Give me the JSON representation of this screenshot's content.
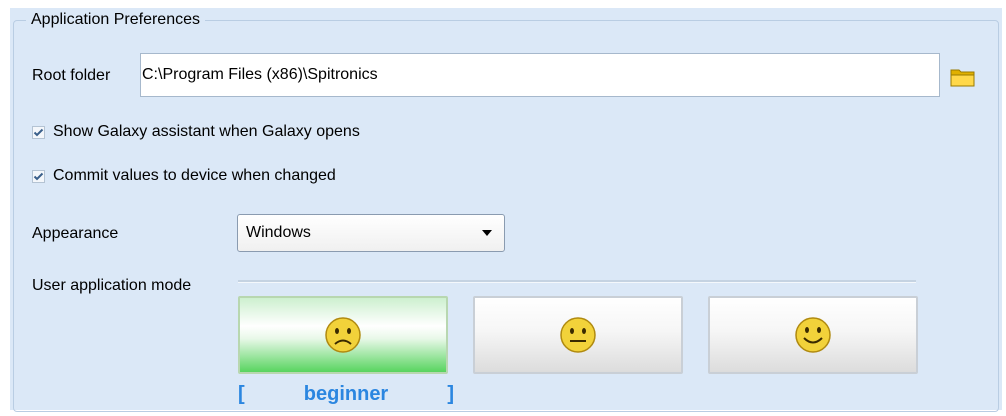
{
  "group": {
    "title": "Application Preferences"
  },
  "root_folder": {
    "label": "Root folder",
    "value": "C:\\Program Files (x86)\\Spitronics"
  },
  "options": [
    {
      "label": "Show Galaxy assistant when Galaxy opens",
      "checked": true
    },
    {
      "label": "Commit values to device when changed",
      "checked": true
    }
  ],
  "appearance": {
    "label": "Appearance",
    "selected": "Windows"
  },
  "user_mode": {
    "label": "User application mode",
    "modes": [
      {
        "icon": "sad-face-icon",
        "active": true
      },
      {
        "icon": "neutral-face-icon",
        "active": false
      },
      {
        "icon": "happy-face-icon",
        "active": false
      }
    ],
    "caption_open": "[",
    "caption_text": "beginner",
    "caption_close": "]"
  },
  "colors": {
    "panel": "#dbe8f7",
    "active_green": "#58d45f",
    "caption_blue": "#2b86e0",
    "face_yellow": "#f2d23a"
  }
}
